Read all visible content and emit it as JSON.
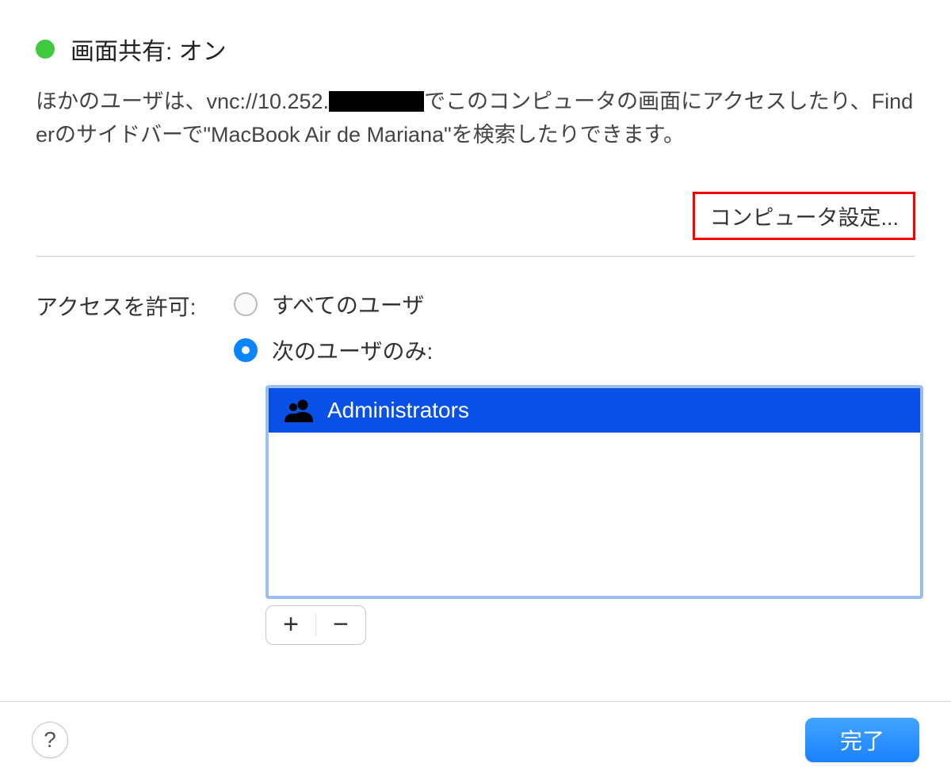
{
  "header": {
    "title": "画面共有: オン",
    "status": "on"
  },
  "description": {
    "prefix": "ほかのユーザは、vnc://10.252.",
    "suffix": "でこのコンピュータの画面にアクセスしたり、Finderのサイドバーで\"MacBook Air de Mariana\"を検索したりできます。"
  },
  "buttons": {
    "computer_settings": "コンピュータ設定...",
    "done": "完了",
    "help": "?"
  },
  "access": {
    "label": "アクセスを許可:",
    "option_all": "すべてのユーザ",
    "option_only": "次のユーザのみ:",
    "selected": "only"
  },
  "user_list": [
    {
      "name": "Administrators"
    }
  ],
  "add_remove": {
    "add": "+",
    "remove": "−"
  }
}
